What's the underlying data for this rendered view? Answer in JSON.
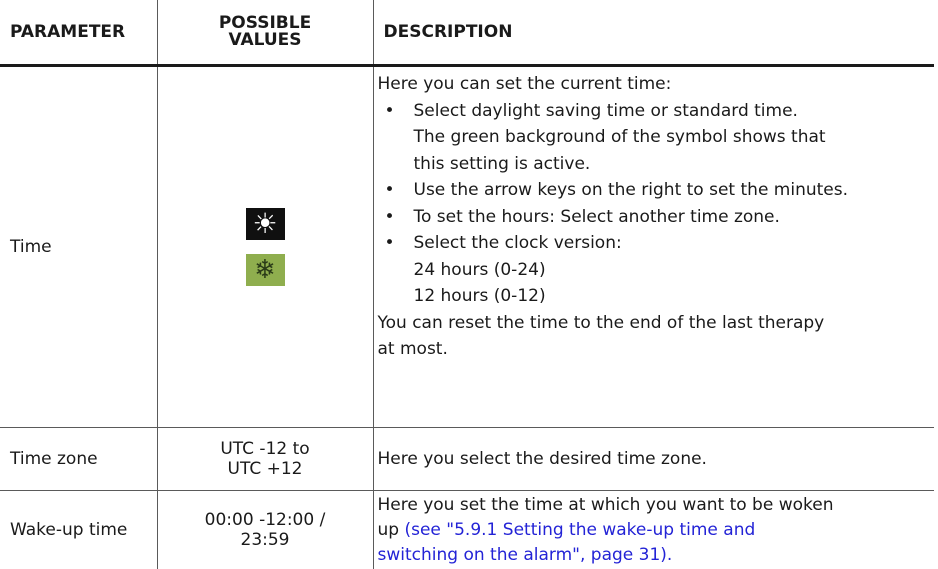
{
  "header": {
    "parameter": "PARAMETER",
    "possible_values_line1": "POSSIBLE",
    "possible_values_line2": "VALUES",
    "description": "DESCRIPTION"
  },
  "rows": [
    {
      "parameter": "Time",
      "icons": [
        "sun-icon",
        "snowflake-icon"
      ],
      "description": {
        "intro": "Here you can set the current time:",
        "bullet1": "Select daylight saving time or standard time.",
        "bullet1_note_line1": "The green background of the symbol shows that",
        "bullet1_note_line2": "this setting is active.",
        "bullet2": "Use the arrow keys on the right to set the minutes.",
        "bullet3": "To set the hours: Select another time zone.",
        "bullet4": "Select the clock version:",
        "option1": "24 hours (0-24)",
        "option2": "12 hours (0-12)",
        "footer_line1": "You can reset the time to the end of the last therapy",
        "footer_line2": "at most."
      }
    },
    {
      "parameter": "Time zone",
      "values_line1": "UTC -12 to",
      "values_line2": "UTC +12",
      "description": "Here you select the desired time zone."
    },
    {
      "parameter": "Wake-up time",
      "values_line1": "00:00 -12:00 /",
      "values_line2": "23:59",
      "description_line1": "Here you set the time at which you want to be woken",
      "description_line2_prefix": "up",
      "link_line1": "(see \"5.9.1 Setting the wake-up time and",
      "link_line2": "switching on the alarm\", page 31)",
      "link_suffix": "."
    }
  ],
  "colors": {
    "sun_icon_bg": "#101010",
    "snow_icon_bg": "#8fae4e",
    "link": "#2323d6"
  }
}
